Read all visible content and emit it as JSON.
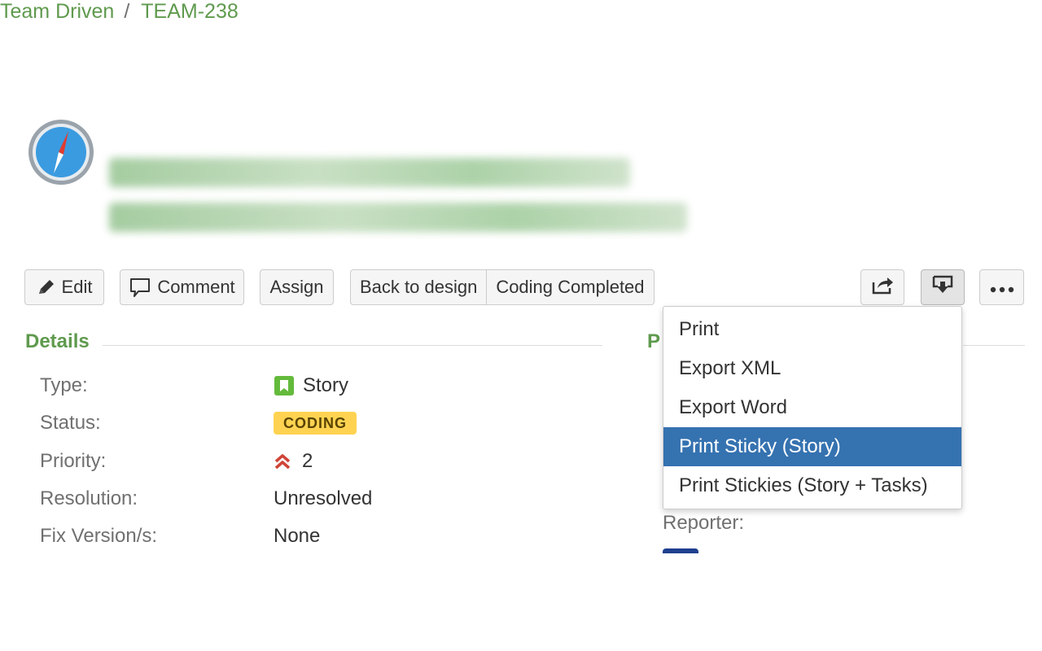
{
  "header": {
    "project_name": "Team Driven",
    "breadcrumb_separator": "/",
    "issue_key": "TEAM-238"
  },
  "toolbar": {
    "edit_label": "Edit",
    "comment_label": "Comment",
    "assign_label": "Assign",
    "workflow": [
      "Back to design",
      "Coding Completed"
    ],
    "share_icon": "share-icon",
    "export_icon": "export-icon",
    "more_icon": "more-icon"
  },
  "details": {
    "heading": "Details",
    "fields": {
      "type_label": "Type:",
      "type_value": "Story",
      "status_label": "Status:",
      "status_value": "CODING",
      "priority_label": "Priority:",
      "priority_value": "2",
      "resolution_label": "Resolution:",
      "resolution_value": "Unresolved",
      "fix_version_label": "Fix Version/s:",
      "fix_version_value": "None"
    }
  },
  "people": {
    "heading_visible": "P",
    "reporter_label": "Reporter:"
  },
  "export_menu": {
    "items": [
      "Print",
      "Export XML",
      "Export Word",
      "Print Sticky (Story)",
      "Print Stickies (Story + Tasks)"
    ],
    "active_index": 3
  },
  "colors": {
    "link_green": "#5f9a4e",
    "highlight_blue": "#3572b0",
    "status_yellow": "#ffd351",
    "priority_red": "#d04437",
    "story_green": "#63ba3c"
  }
}
